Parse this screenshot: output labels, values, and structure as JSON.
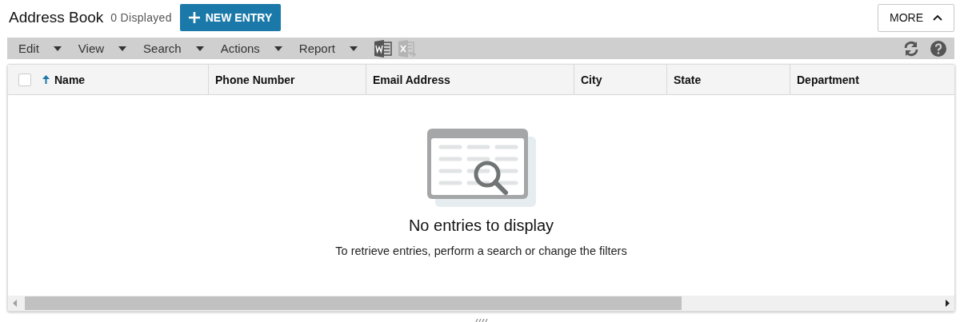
{
  "header": {
    "title": "Address Book",
    "count": "0 Displayed",
    "new_button": "NEW ENTRY",
    "more_button": "MORE"
  },
  "toolbar": {
    "menus": [
      {
        "label": "Edit"
      },
      {
        "label": "View"
      },
      {
        "label": "Search"
      },
      {
        "label": "Actions"
      },
      {
        "label": "Report"
      }
    ],
    "exports": [
      {
        "kind": "word",
        "disabled": false
      },
      {
        "kind": "excel",
        "disabled": true
      }
    ]
  },
  "table": {
    "select_all": {
      "checked": false
    },
    "columns": [
      {
        "label": "Name",
        "sorted": true
      },
      {
        "label": "Phone Number",
        "sorted": false
      },
      {
        "label": "Email Address",
        "sorted": false
      },
      {
        "label": "City",
        "sorted": false
      },
      {
        "label": "State",
        "sorted": false
      },
      {
        "label": "Department",
        "sorted": false
      }
    ],
    "empty_title": "No entries to display",
    "empty_hint": "To retrieve entries, perform a search or change the filters"
  }
}
